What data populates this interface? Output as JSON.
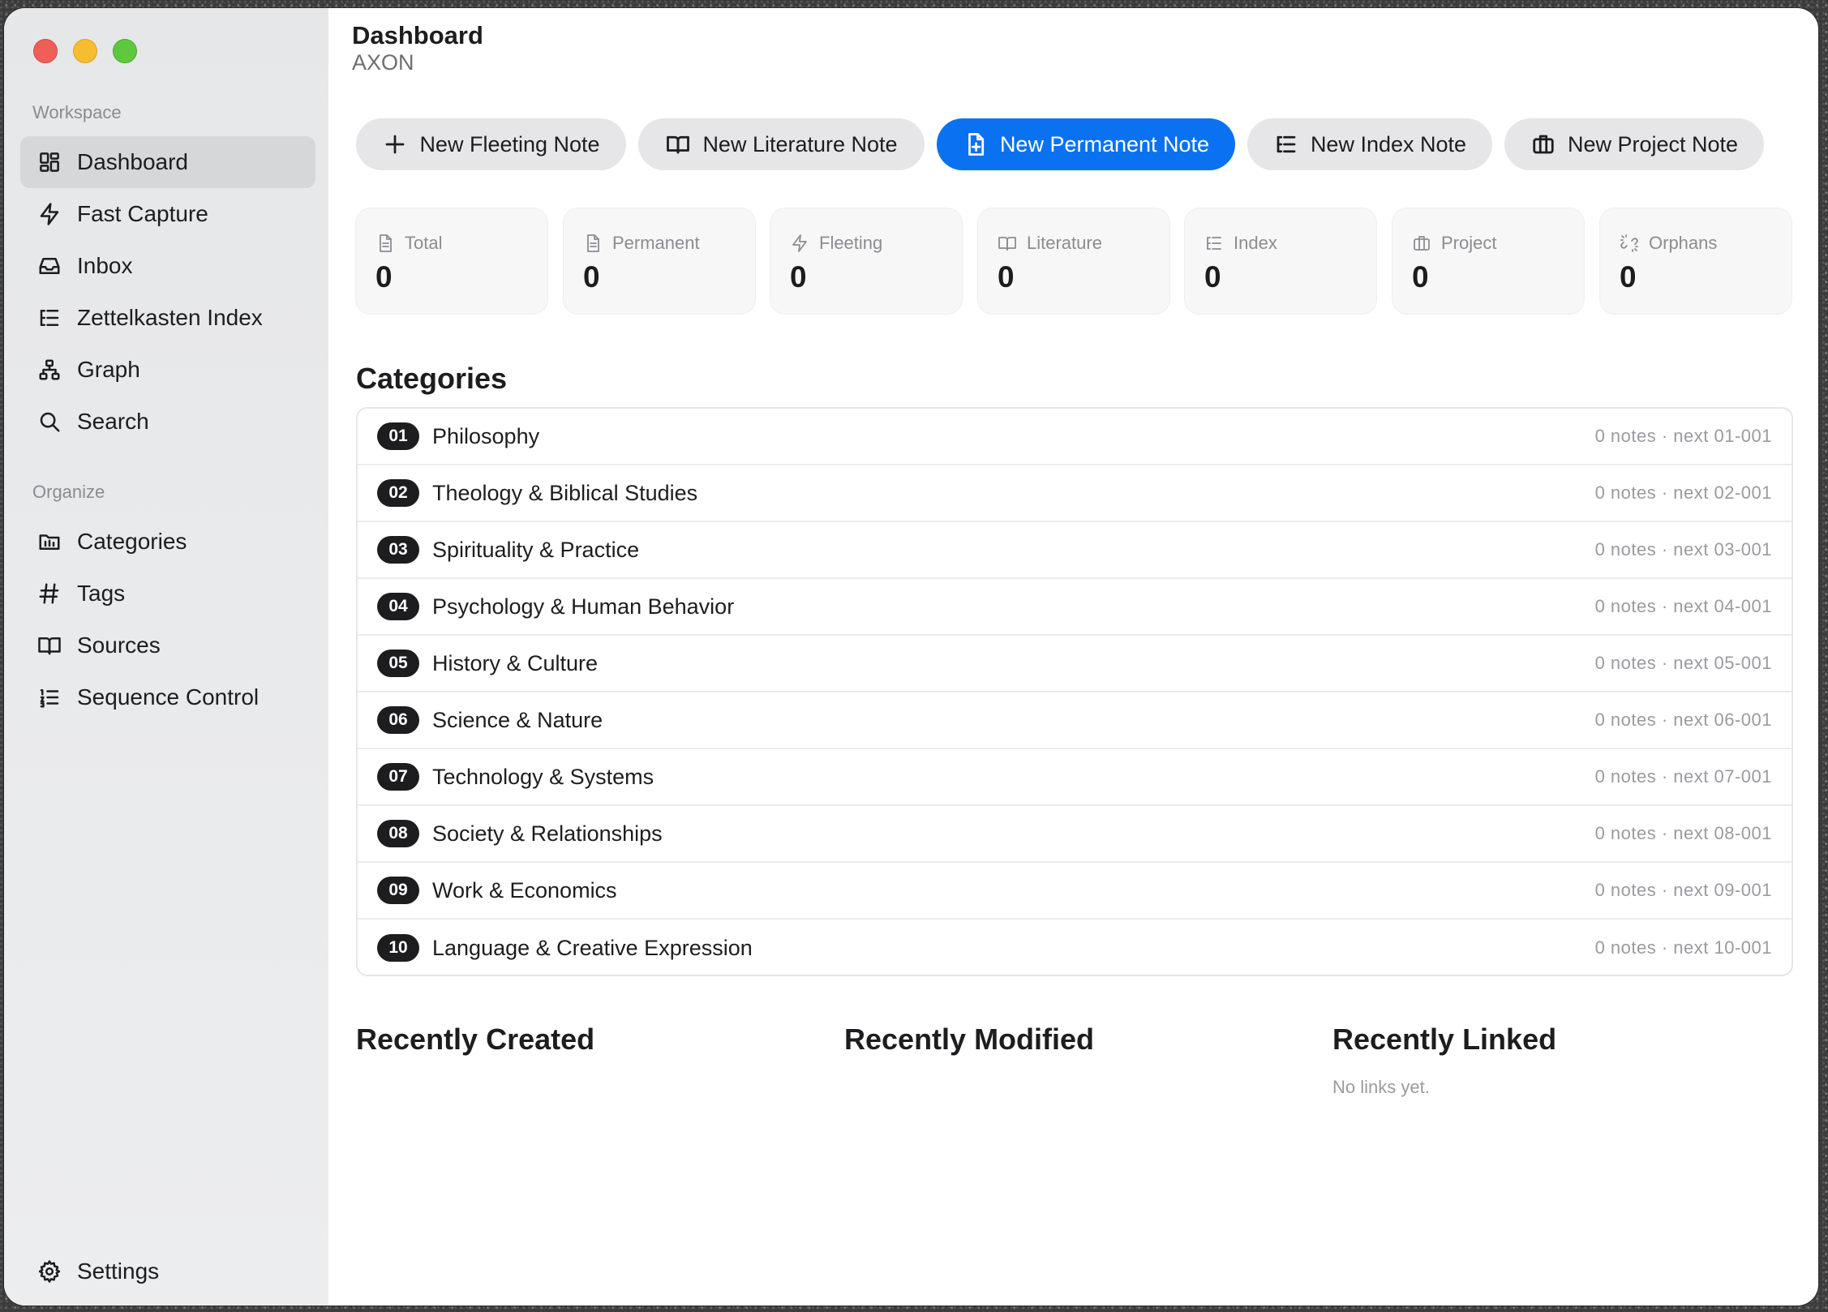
{
  "window": {
    "traffic_lights": [
      "close",
      "minimize",
      "zoom"
    ]
  },
  "sidebar": {
    "workspace_label": "Workspace",
    "organize_label": "Organize",
    "workspace_items": [
      {
        "label": "Dashboard",
        "icon": "dashboard-grid-icon",
        "active": true
      },
      {
        "label": "Fast Capture",
        "icon": "lightning-icon"
      },
      {
        "label": "Inbox",
        "icon": "inbox-tray-icon"
      },
      {
        "label": "Zettelkasten Index",
        "icon": "index-list-icon"
      },
      {
        "label": "Graph",
        "icon": "graph-network-icon"
      },
      {
        "label": "Search",
        "icon": "search-icon"
      }
    ],
    "organize_items": [
      {
        "label": "Categories",
        "icon": "folder-chart-icon"
      },
      {
        "label": "Tags",
        "icon": "hash-icon"
      },
      {
        "label": "Sources",
        "icon": "book-open-icon"
      },
      {
        "label": "Sequence Control",
        "icon": "numbered-list-icon"
      }
    ],
    "settings_label": "Settings"
  },
  "header": {
    "title": "Dashboard",
    "subtitle": "AXON"
  },
  "actions": [
    {
      "label": "New Fleeting Note",
      "icon": "plus-icon"
    },
    {
      "label": "New Literature Note",
      "icon": "book-open-icon"
    },
    {
      "label": "New Permanent Note",
      "icon": "document-plus-icon",
      "primary": true
    },
    {
      "label": "New Index Note",
      "icon": "index-list-icon"
    },
    {
      "label": "New Project Note",
      "icon": "briefcase-icon"
    }
  ],
  "stats": [
    {
      "label": "Total",
      "value": "0",
      "icon": "document-icon"
    },
    {
      "label": "Permanent",
      "value": "0",
      "icon": "document-icon"
    },
    {
      "label": "Fleeting",
      "value": "0",
      "icon": "lightning-icon"
    },
    {
      "label": "Literature",
      "value": "0",
      "icon": "book-open-icon"
    },
    {
      "label": "Index",
      "value": "0",
      "icon": "index-list-icon"
    },
    {
      "label": "Project",
      "value": "0",
      "icon": "briefcase-icon"
    },
    {
      "label": "Orphans",
      "value": "0",
      "icon": "broken-link-icon"
    }
  ],
  "categories": {
    "heading": "Categories",
    "items": [
      {
        "num": "01",
        "name": "Philosophy",
        "meta": "0 notes · next 01-001"
      },
      {
        "num": "02",
        "name": "Theology & Biblical Studies",
        "meta": "0 notes · next 02-001"
      },
      {
        "num": "03",
        "name": "Spirituality & Practice",
        "meta": "0 notes · next 03-001"
      },
      {
        "num": "04",
        "name": "Psychology & Human Behavior",
        "meta": "0 notes · next 04-001"
      },
      {
        "num": "05",
        "name": "History & Culture",
        "meta": "0 notes · next 05-001"
      },
      {
        "num": "06",
        "name": "Science & Nature",
        "meta": "0 notes · next 06-001"
      },
      {
        "num": "07",
        "name": "Technology & Systems",
        "meta": "0 notes · next 07-001"
      },
      {
        "num": "08",
        "name": "Society & Relationships",
        "meta": "0 notes · next 08-001"
      },
      {
        "num": "09",
        "name": "Work & Economics",
        "meta": "0 notes · next 09-001"
      },
      {
        "num": "10",
        "name": "Language & Creative Expression",
        "meta": "0 notes · next 10-001"
      }
    ]
  },
  "recent": {
    "created_heading": "Recently Created",
    "modified_heading": "Recently Modified",
    "linked_heading": "Recently Linked",
    "linked_empty": "No links yet."
  },
  "colors": {
    "accent": "#0a72f0",
    "sidebar_bg": "#e9eaeb",
    "badge_bg": "#1d1d1f"
  }
}
